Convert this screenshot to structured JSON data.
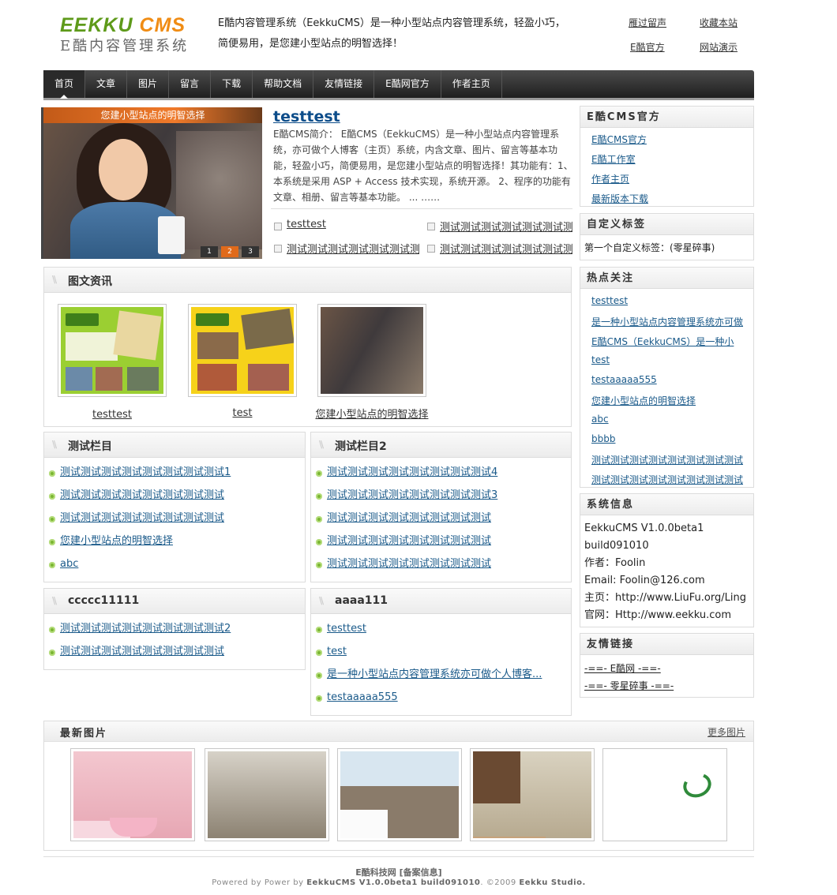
{
  "header": {
    "logo_line1": "EEKKU",
    "logo_line1_accent": "CMS",
    "logo_line2": "E酷内容管理系统",
    "intro_line1": "E酷内容管理系统（EekkuCMS）是一种小型站点内容管理系统，轻盈小巧，",
    "intro_line2": "简便易用，是您建小型站点的明智选择！",
    "links": [
      "雁过留声",
      "收藏本站",
      "E酷官方",
      "网站演示"
    ]
  },
  "nav": {
    "items": [
      "首页",
      "文章",
      "图片",
      "留言",
      "下载",
      "帮助文档",
      "友情链接",
      "E酷网官方",
      "作者主页"
    ],
    "active_index": 0
  },
  "slideshow": {
    "caption": "您建小型站点的明智选择",
    "pages": [
      "1",
      "2",
      "3"
    ],
    "current": "2"
  },
  "featured": {
    "title": "testtest",
    "body": "E酷CMS简介： E酷CMS（EekkuCMS）是一种小型站点内容管理系统，亦可做个人博客（主页）系统，内含文章、图片、留言等基本功能，轻盈小巧，简便易用，是您建小型站点的明智选择！其功能有：1、本系统是采用 ASP + Access 技术实现，系统开源。  2、程序的功能有文章、相册、留言等基本功能。 ... ……",
    "links": [
      "testtest",
      "测试测试测试测试测试测试测试",
      "测试测试测试测试测试测试测试",
      "测试测试测试测试测试测试测试"
    ]
  },
  "photo_news": {
    "title": "图文资讯",
    "items": [
      {
        "caption": "testtest"
      },
      {
        "caption": "test"
      },
      {
        "caption": "您建小型站点的明智选择"
      }
    ]
  },
  "sections": [
    {
      "title": "测试栏目",
      "items": [
        "测试测试测试测试测试测试测试测试1",
        "测试测试测试测试测试测试测试测试",
        "测试测试测试测试测试测试测试测试",
        "您建小型站点的明智选择",
        "abc"
      ]
    },
    {
      "title": "测试栏目2",
      "items": [
        "测试测试测试测试测试测试测试测试4",
        "测试测试测试测试测试测试测试测试3",
        "测试测试测试测试测试测试测试测试",
        "测试测试测试测试测试测试测试测试",
        "测试测试测试测试测试测试测试测试"
      ]
    },
    {
      "title": "ccccc11111",
      "items": [
        "测试测试测试测试测试测试测试测试2",
        "测试测试测试测试测试测试测试测试"
      ]
    },
    {
      "title": "aaaa111",
      "items": [
        "testtest",
        "test",
        "是一种小型站点内容管理系统亦可做个人博客...",
        "testaaaaa555"
      ]
    }
  ],
  "sidebar": {
    "official": {
      "title": "E酷CMS官方",
      "links": [
        "E酷CMS官方",
        "E酷工作室",
        "作者主页",
        "最新版本下载"
      ]
    },
    "custom": {
      "title": "自定义标签",
      "text": "第一个自定义标签：(零星碎事)"
    },
    "hot": {
      "title": "热点关注",
      "links": [
        "testtest",
        "是一种小型站点内容管理系统亦可做",
        "E酷CMS（EekkuCMS）是一种小",
        "test",
        "testaaaaa555",
        "您建小型站点的明智选择",
        "abc",
        "bbbb",
        "测试测试测试测试测试测试测试测试",
        "测试测试测试测试测试测试测试测试"
      ]
    },
    "sysinfo": {
      "title": "系统信息",
      "lines": [
        "EekkuCMS V1.0.0beta1",
        "build091010",
        "作者：Foolin",
        "Email: Foolin@126.com",
        "主页：http://www.LiuFu.org/Ling",
        "官网：Http://www.eekku.com"
      ]
    },
    "friends": {
      "title": "友情链接",
      "links": [
        "-==- E酷网 -==-",
        "-==- 零星碎事 -==-"
      ]
    }
  },
  "latest": {
    "title": "最新图片",
    "more": "更多图片"
  },
  "footer": {
    "line1": "E酷科技网 [备案信息]",
    "line2_pre": "Powered by Power by ",
    "line2_bold": "EekkuCMS V1.0.0beta1 build091010",
    "line2_mid": ". ©2009 ",
    "line2_end": "Eekku Studio."
  },
  "colors": {
    "nav_bg": "#2a2a2a",
    "link": "#1a5a8a",
    "title_link": "#0d4d8a",
    "bullet": "#7ab532",
    "slide_caption": "#e06a1a"
  }
}
